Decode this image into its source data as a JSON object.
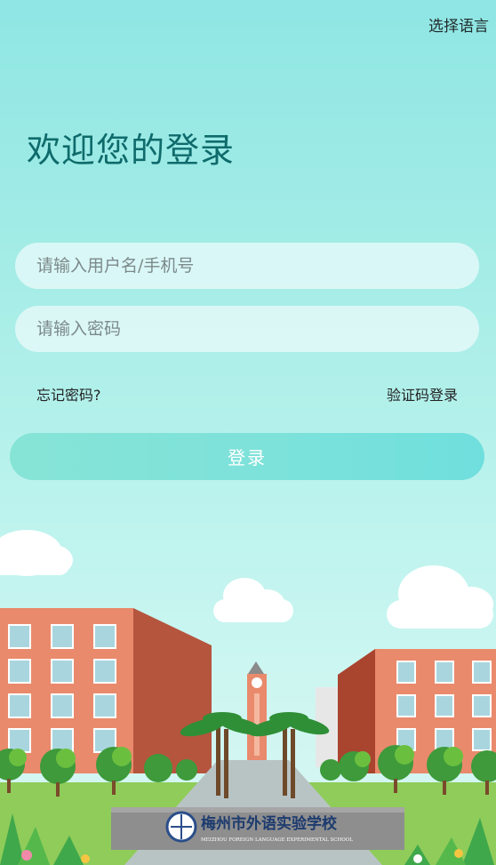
{
  "header": {
    "language_label": "选择语言"
  },
  "welcome": {
    "title": "欢迎您的登录"
  },
  "form": {
    "username_placeholder": "请输入用户名/手机号",
    "password_placeholder": "请输入密码",
    "forgot_label": "忘记密码?",
    "sms_login_label": "验证码登录",
    "submit_label": "登录"
  },
  "illustration": {
    "school_name_cn": "梅州市外语实验学校",
    "school_name_en": "MEIZHOU FOREIGN LANGUAGE EXPERIMENTAL SCHOOL"
  },
  "colors": {
    "background_top": "#8fe6e4",
    "title": "#0f6b6b",
    "button_start": "#86e4d6",
    "button_end": "#6fdfdd",
    "building_brick": "#e98a6c",
    "building_shadow": "#b5553e"
  }
}
